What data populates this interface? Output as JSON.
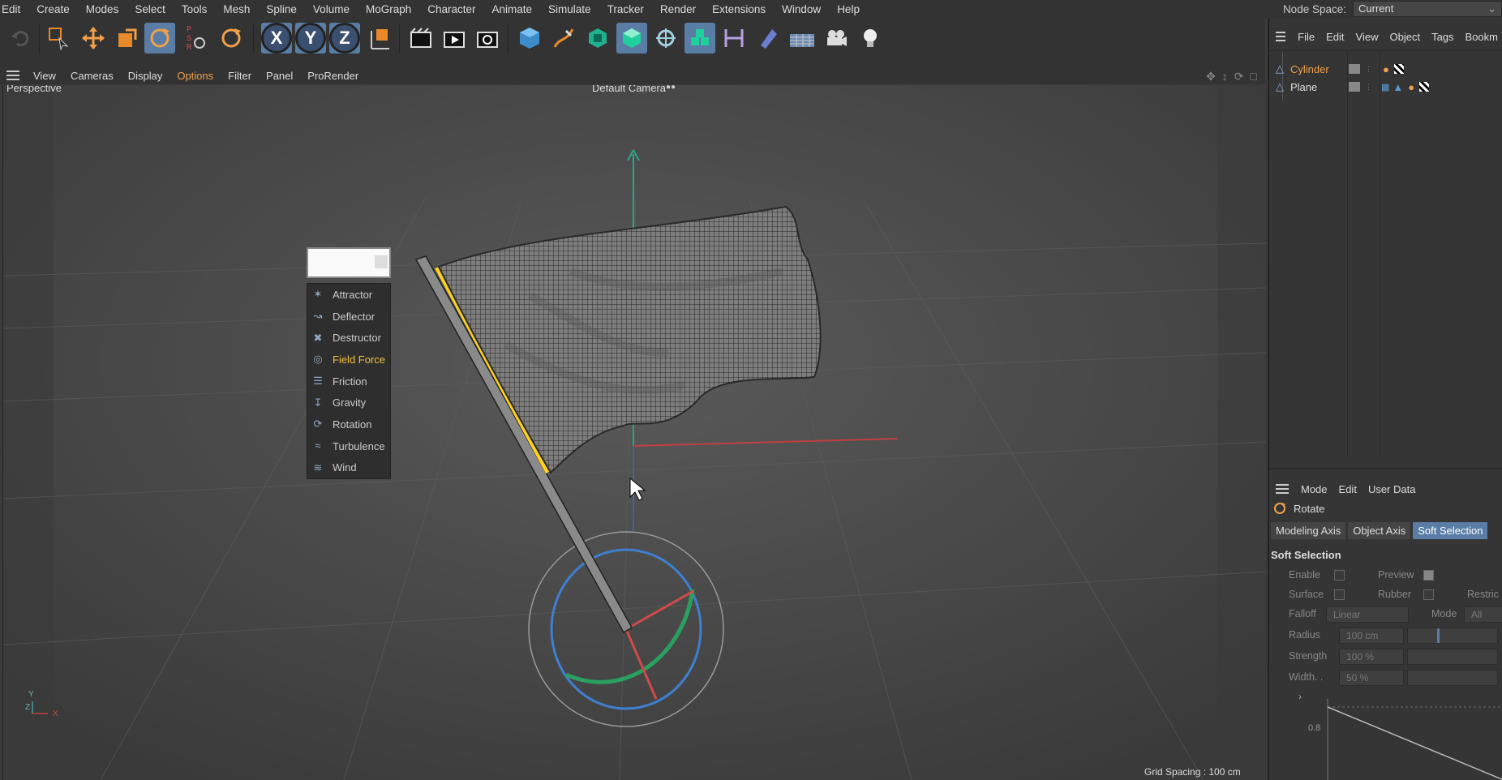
{
  "menubar": {
    "items": [
      "Edit",
      "Create",
      "Modes",
      "Select",
      "Tools",
      "Mesh",
      "Spline",
      "Volume",
      "MoGraph",
      "Character",
      "Animate",
      "Simulate",
      "Tracker",
      "Render",
      "Extensions",
      "Window",
      "Help"
    ],
    "node_space_label": "Node Space:",
    "node_space_value": "Current (Standard/Physical)"
  },
  "toolbar": {
    "axis_x": "X",
    "axis_y": "Y",
    "axis_z": "Z",
    "icons": [
      "undo-icon",
      "live-selection-icon",
      "move-icon",
      "scale-icon",
      "rotate-icon",
      "psr-icon",
      "rotate-reset-icon",
      "axis-x-icon",
      "axis-y-icon",
      "axis-z-icon",
      "world-coordinates-icon",
      "render-view-icon",
      "render-picture-viewer-icon",
      "render-settings-icon",
      "cube-icon",
      "pen-icon",
      "subdivision-icon",
      "cloner-icon",
      "volume-icon",
      "instance-icon",
      "measure-icon",
      "deformer-icon",
      "floor-icon",
      "camera-icon",
      "light-icon"
    ]
  },
  "viewport_menu": {
    "items": [
      "View",
      "Cameras",
      "Display",
      "Options",
      "Filter",
      "Panel",
      "ProRender"
    ],
    "highlight": "Options"
  },
  "viewport": {
    "label": "Perspective",
    "camera": "Default Camera",
    "grid_spacing": "Grid Spacing : 100 cm",
    "axis_y": "Y",
    "axis_z": "Z",
    "axis_x": "X"
  },
  "field_menu": {
    "items": [
      "Attractor",
      "Deflector",
      "Destructor",
      "Field Force",
      "Friction",
      "Gravity",
      "Rotation",
      "Turbulence",
      "Wind"
    ],
    "highlighted": "Field Force"
  },
  "object_manager": {
    "menu": [
      "File",
      "Edit",
      "View",
      "Object",
      "Tags",
      "Bookm"
    ],
    "objects": [
      {
        "name": "Cylinder",
        "selected": true
      },
      {
        "name": "Plane",
        "selected": false
      }
    ]
  },
  "attributes": {
    "menu": [
      "Mode",
      "Edit",
      "User Data"
    ],
    "tool": "Rotate",
    "tabs": [
      "Modeling Axis",
      "Object Axis",
      "Soft Selection"
    ],
    "active_tab": "Soft Selection",
    "section": "Soft Selection",
    "enable": "Enable",
    "preview": "Preview",
    "surface": "Surface",
    "rubber": "Rubber",
    "restrict": "Restric",
    "falloff_label": "Falloff",
    "falloff_value": "Linear",
    "mode_label": "Mode",
    "mode_value": "All",
    "radius_label": "Radius",
    "radius_value": "100 cm",
    "strength_label": "Strength",
    "strength_value": "100 %",
    "width_label": "Width. .",
    "width_value": "50 %",
    "graph_tick": "0.8"
  },
  "colors": {
    "accent": "#5a7da6",
    "highlight": "#f0a04a",
    "menu_highlight": "#f5c040"
  }
}
